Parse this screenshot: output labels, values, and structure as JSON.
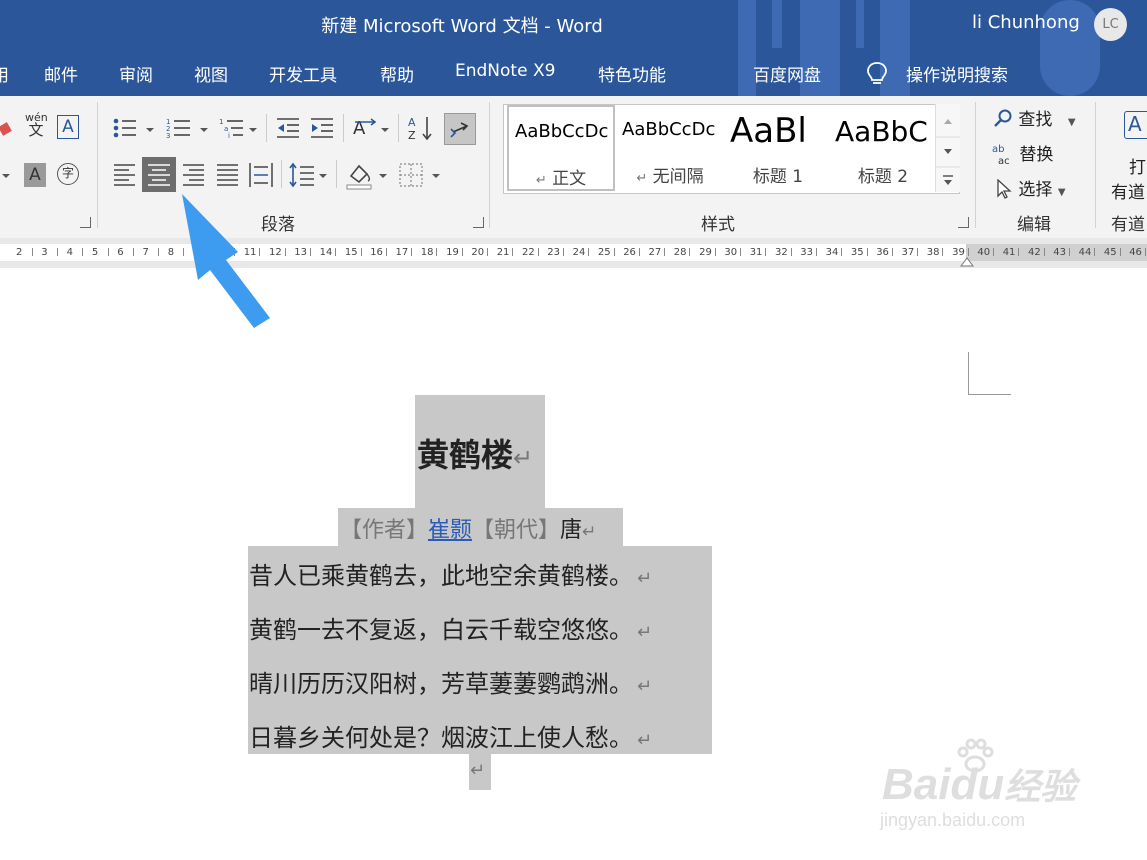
{
  "titlebar": {
    "doc_title": "新建 Microsoft Word 文档  -  Word",
    "user_name": "li Chunhong",
    "avatar_initials": "LC"
  },
  "menu": {
    "tabs": [
      {
        "label": "用"
      },
      {
        "label": "邮件"
      },
      {
        "label": "审阅"
      },
      {
        "label": "视图"
      },
      {
        "label": "开发工具"
      },
      {
        "label": "帮助"
      },
      {
        "label": "EndNote X9"
      },
      {
        "label": "特色功能"
      },
      {
        "label": "百度网盘"
      }
    ],
    "tell_me": "操作说明搜索",
    "bulb_icon": "lightbulb-icon"
  },
  "ribbon": {
    "paragraph_group_label": "段落",
    "styles_group_label": "样式",
    "editing_group_label": "编辑",
    "youdao_group_label": "有道",
    "font_icons": {
      "pinyin": "wén",
      "pinyin_char": "文",
      "border_char": "A",
      "shade_char": "A",
      "enclose_char": "字"
    },
    "styles": [
      {
        "sample": "AaBbCcDc",
        "name": "正文",
        "mark": "↵"
      },
      {
        "sample": "AaBbCcDc",
        "name": "无间隔",
        "mark": "↵"
      },
      {
        "sample": "AaBl",
        "name": "标题 1"
      },
      {
        "sample": "AaBbC",
        "name": "标题 2"
      }
    ],
    "editing": {
      "find": "查找",
      "replace": "替换",
      "select": "选择"
    },
    "youdao": {
      "char": "A",
      "line1": "打",
      "line2": "有道"
    }
  },
  "ruler": {
    "labels": [
      "2",
      "3",
      "4",
      "5",
      "6",
      "7",
      "8",
      "9",
      "10",
      "11",
      "12",
      "13",
      "14",
      "15",
      "16",
      "17",
      "18",
      "19",
      "20",
      "21",
      "22",
      "23",
      "24",
      "25",
      "26",
      "27",
      "28",
      "29",
      "30",
      "31",
      "32",
      "33",
      "34",
      "35",
      "36",
      "37",
      "38",
      "39",
      "40",
      "41",
      "42",
      "43",
      "44",
      "45",
      "46"
    ]
  },
  "document": {
    "title": "黄鹤楼",
    "paragraph_mark": "↵",
    "byline": {
      "author_tag": "【作者】",
      "author": "崔颢",
      "dynasty_tag": "【朝代】",
      "dynasty": "唐"
    },
    "lines": [
      "昔人已乘黄鹤去，此地空余黄鹤楼。",
      "黄鹤一去不复返，白云千载空悠悠。",
      "晴川历历汉阳树，芳草萋萋鹦鹉洲。",
      "日暮乡关何处是？烟波江上使人愁。"
    ]
  },
  "watermark": {
    "brand": "Bai",
    "brand2": "du",
    "brand_cn": "经验",
    "url": "jingyan.baidu.com"
  },
  "colors": {
    "accent": "#2b579a",
    "selection": "#c8c8c8",
    "arrow": "#3d9cf0"
  }
}
